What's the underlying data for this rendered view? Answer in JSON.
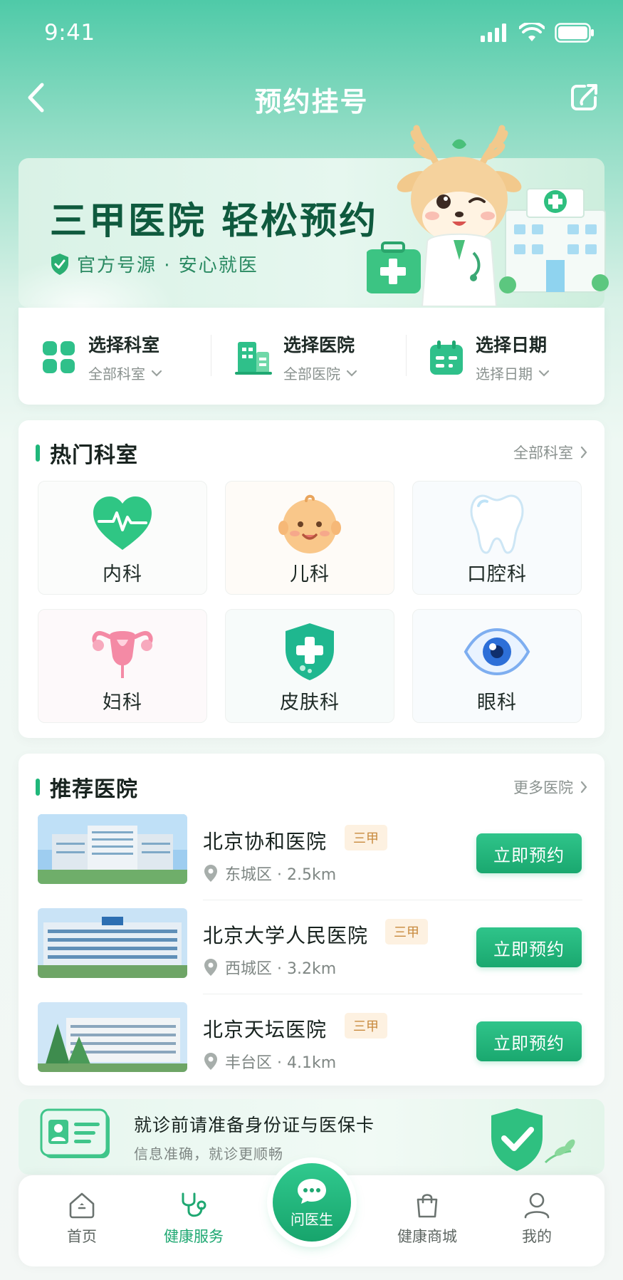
{
  "status": {
    "time": "9:41"
  },
  "nav": {
    "title": "预约挂号"
  },
  "banner": {
    "title": "三甲医院  轻松预约",
    "subtitle": "官方号源 · 安心就医"
  },
  "filters": [
    {
      "title": "选择科室",
      "sub": "全部科室",
      "icon": "grid-icon"
    },
    {
      "title": "选择医院",
      "sub": "全部医院",
      "icon": "hospital-building-icon"
    },
    {
      "title": "选择日期",
      "sub": "选择日期",
      "icon": "calendar-icon"
    }
  ],
  "hot_departments": {
    "title": "热门科室",
    "more": "全部科室",
    "items": [
      {
        "label": "内科",
        "icon": "heart-pulse-icon"
      },
      {
        "label": "儿科",
        "icon": "baby-face-icon"
      },
      {
        "label": "口腔科",
        "icon": "tooth-icon"
      },
      {
        "label": "妇科",
        "icon": "uterus-icon"
      },
      {
        "label": "皮肤科",
        "icon": "shield-cross-icon"
      },
      {
        "label": "眼科",
        "icon": "eye-icon"
      }
    ]
  },
  "hospitals": {
    "title": "推荐医院",
    "more": "更多医院",
    "items": [
      {
        "name": "北京协和医院",
        "badge": "三甲",
        "location": "东城区 · 2.5km",
        "button": "立即预约"
      },
      {
        "name": "北京大学人民医院",
        "badge": "三甲",
        "location": "西城区 · 3.2km",
        "button": "立即预约"
      },
      {
        "name": "北京天坛医院",
        "badge": "三甲",
        "location": "丰台区 · 4.1km",
        "button": "立即预约"
      }
    ]
  },
  "tip": {
    "title": "就诊前请准备身份证与医保卡",
    "subtitle": "信息准确，就诊更顺畅"
  },
  "tabbar": [
    {
      "label": "首页",
      "icon": "home-icon"
    },
    {
      "label": "健康服务",
      "icon": "stethoscope-icon",
      "active": true
    },
    {
      "label": "问医生",
      "icon": "chat-bubble-icon"
    },
    {
      "label": "健康商城",
      "icon": "shopping-bag-icon"
    },
    {
      "label": "我的",
      "icon": "user-icon"
    }
  ],
  "colors": {
    "brand": "#1fb77a",
    "badge_bg": "#fdf1e1",
    "badge_text": "#c88a3e"
  }
}
